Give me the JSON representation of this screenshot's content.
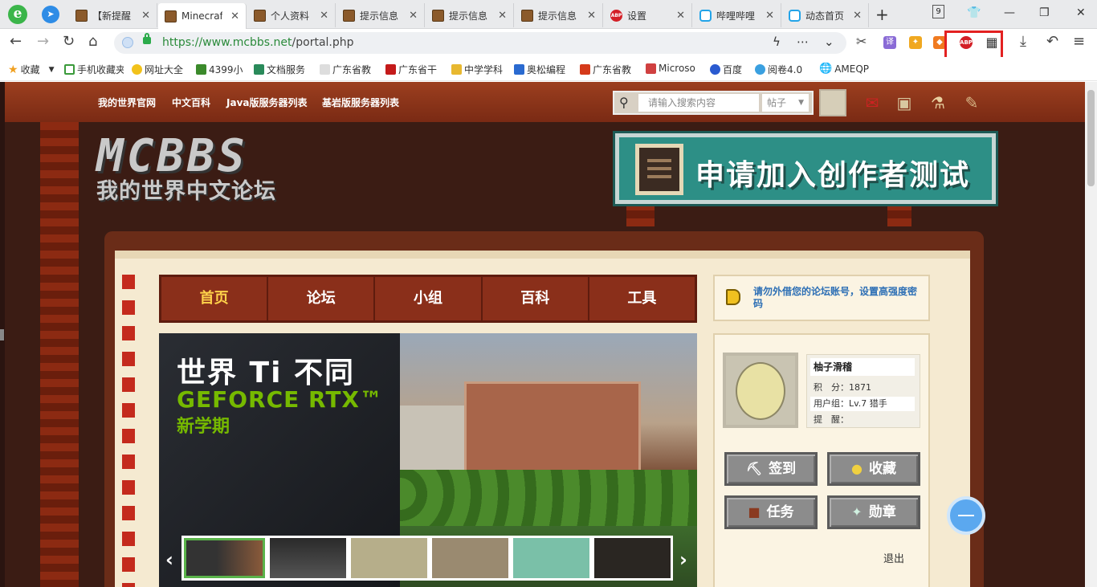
{
  "tabs": [
    {
      "label": "【新提醒",
      "icon": "minecraft-box-icon"
    },
    {
      "label": "Minecraft",
      "icon": "minecraft-box-icon",
      "active": true
    },
    {
      "label": "个人资料",
      "icon": "minecraft-box-icon"
    },
    {
      "label": "提示信息",
      "icon": "minecraft-box-icon"
    },
    {
      "label": "提示信息",
      "icon": "minecraft-box-icon"
    },
    {
      "label": "提示信息",
      "icon": "minecraft-box-icon"
    },
    {
      "label": "设置",
      "icon": "abp-icon"
    },
    {
      "label": "哔哩哔哩",
      "icon": "bilibili-icon"
    },
    {
      "label": "动态首页",
      "icon": "bilibili-icon"
    }
  ],
  "tab_count": "9",
  "address": {
    "scheme_host": "https://www.mcbbs.net",
    "path": "/portal.php"
  },
  "extensions": {
    "abp_label": "ABP"
  },
  "bookmarks": [
    "收藏",
    "手机收藏夹",
    "网址大全",
    "4399小",
    "文档服务",
    "广东省教",
    "广东省干",
    "中学学科",
    "奥松编程",
    "广东省教",
    "Microso",
    "百度",
    "阅卷4.0",
    "AMEQP"
  ],
  "site": {
    "top_links": [
      "我的世界官网",
      "中文百科",
      "Java版服务器列表",
      "基岩版服务器列表"
    ],
    "search_placeholder": "请输入搜索内容",
    "search_scope": "帖子",
    "logo_big": "MCBBS",
    "logo_small": "我的世界中文论坛",
    "creator_banner": "申请加入创作者测试",
    "main_nav": [
      "首页",
      "论坛",
      "小组",
      "百科",
      "工具"
    ],
    "slide": {
      "line1": "世界 Ti 不同",
      "line2": "GEFORCE RTX™",
      "line3": "新学期"
    },
    "notice": "请勿外借您的论坛账号，设置高强度密码",
    "user": {
      "name": "柚子滑稽",
      "points": "积　分：1871",
      "group": "用户组：Lv.7 猎手",
      "remind": "提　醒："
    },
    "buttons": [
      "签到",
      "收藏",
      "任务",
      "勋章"
    ],
    "logout": "退出"
  }
}
